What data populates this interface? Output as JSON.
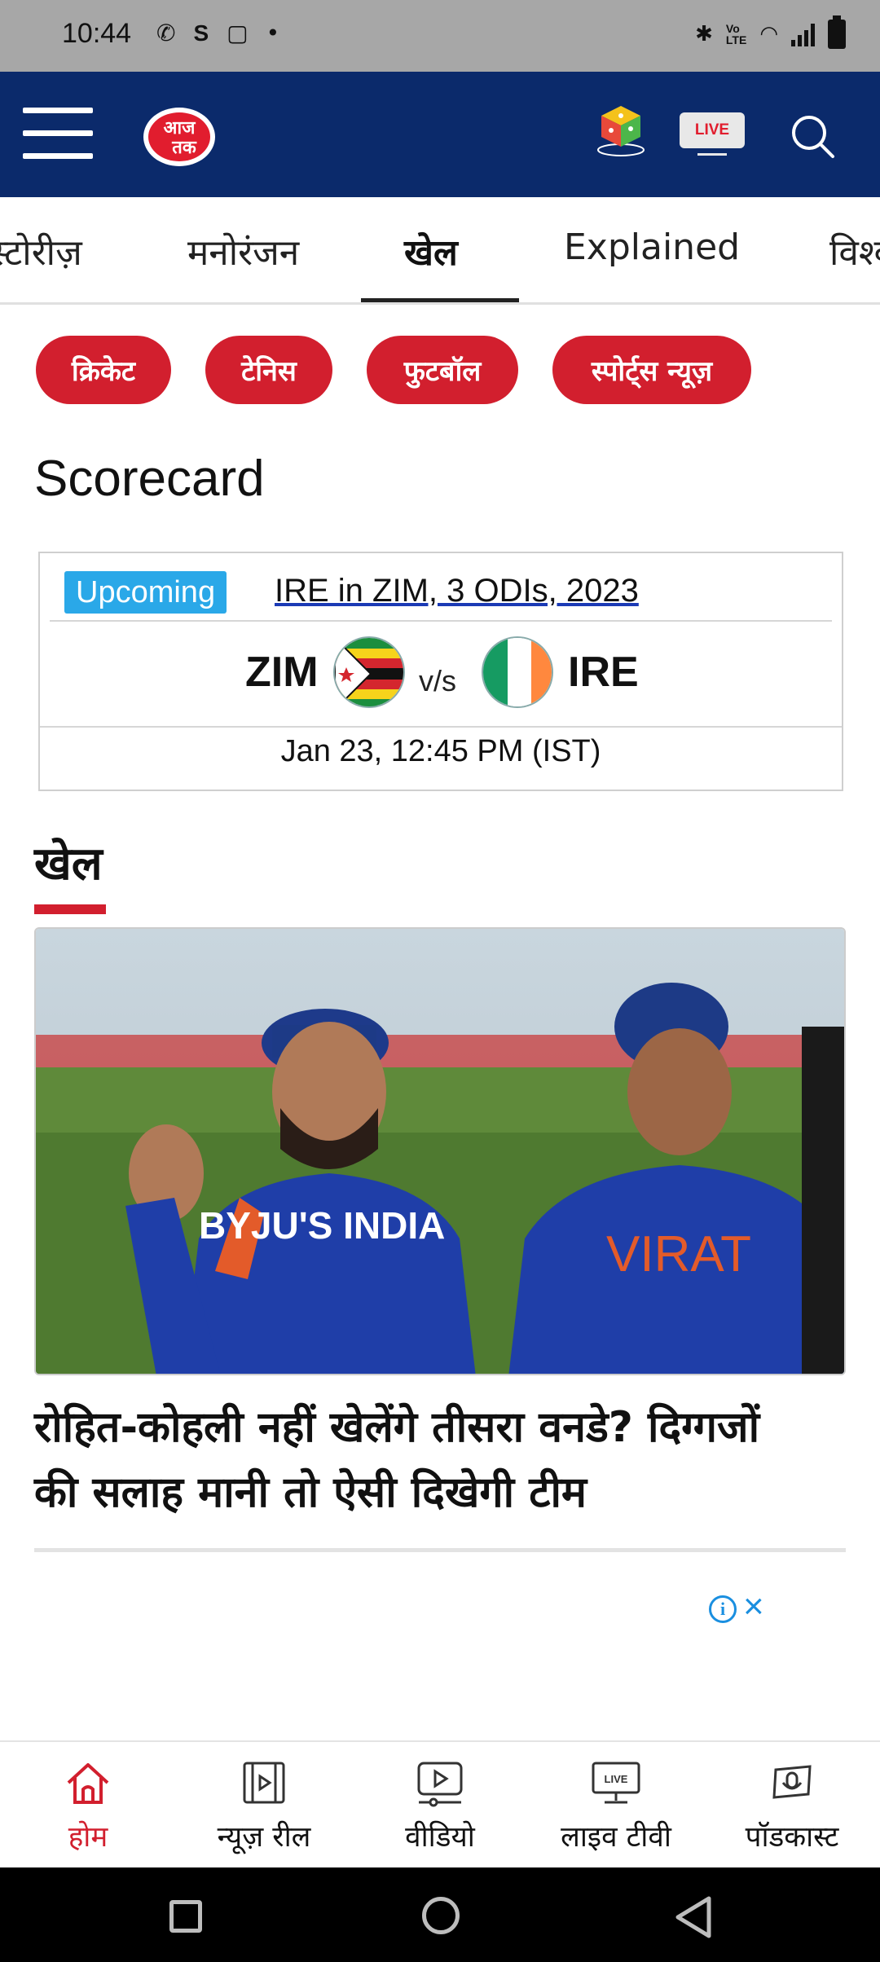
{
  "status_bar": {
    "time": "10:44",
    "volte": "VoLTE",
    "lte": "LTE"
  },
  "header": {
    "brand": "आज तक",
    "live_label": "LIVE"
  },
  "tabs": [
    {
      "label": "स्टोरीज़"
    },
    {
      "label": "मनोरंजन"
    },
    {
      "label": "खेल",
      "active": true
    },
    {
      "label": "Explained"
    },
    {
      "label": "विश्व"
    }
  ],
  "chips": [
    "क्रिकेट",
    "टेनिस",
    "फुटबॉल",
    "स्पोर्ट्स न्यूज़"
  ],
  "scorecard": {
    "heading": "Scorecard",
    "status": "Upcoming",
    "series": "IRE in ZIM, 3 ODIs, 2023",
    "team1": "ZIM",
    "vs": "v/s",
    "team2": "IRE",
    "datetime": "Jan 23, 12:45 PM (IST)"
  },
  "section": {
    "title": "खेल",
    "story": {
      "headline_line1": "रोहित-कोहली नहीं खेलेंगे तीसरा वनडे? दिग्गजों",
      "headline_line2": "की सलाह मानी तो ऐसी दिखेगी टीम",
      "jersey_text_left": "BYJU'S INDIA",
      "jersey_text_right": "VIRAT"
    }
  },
  "bottom_nav": [
    {
      "label": "होम",
      "icon": "home-icon",
      "active": true
    },
    {
      "label": "न्यूज़ रील",
      "icon": "reel-icon"
    },
    {
      "label": "वीडियो",
      "icon": "video-icon"
    },
    {
      "label": "लाइव टीवी",
      "icon": "live-tv-icon"
    },
    {
      "label": "पॉडकास्ट",
      "icon": "podcast-icon"
    }
  ],
  "colors": {
    "header_bg": "#0b2a6b",
    "accent_red": "#d21f2e",
    "upcoming_blue": "#2aa8e8"
  }
}
